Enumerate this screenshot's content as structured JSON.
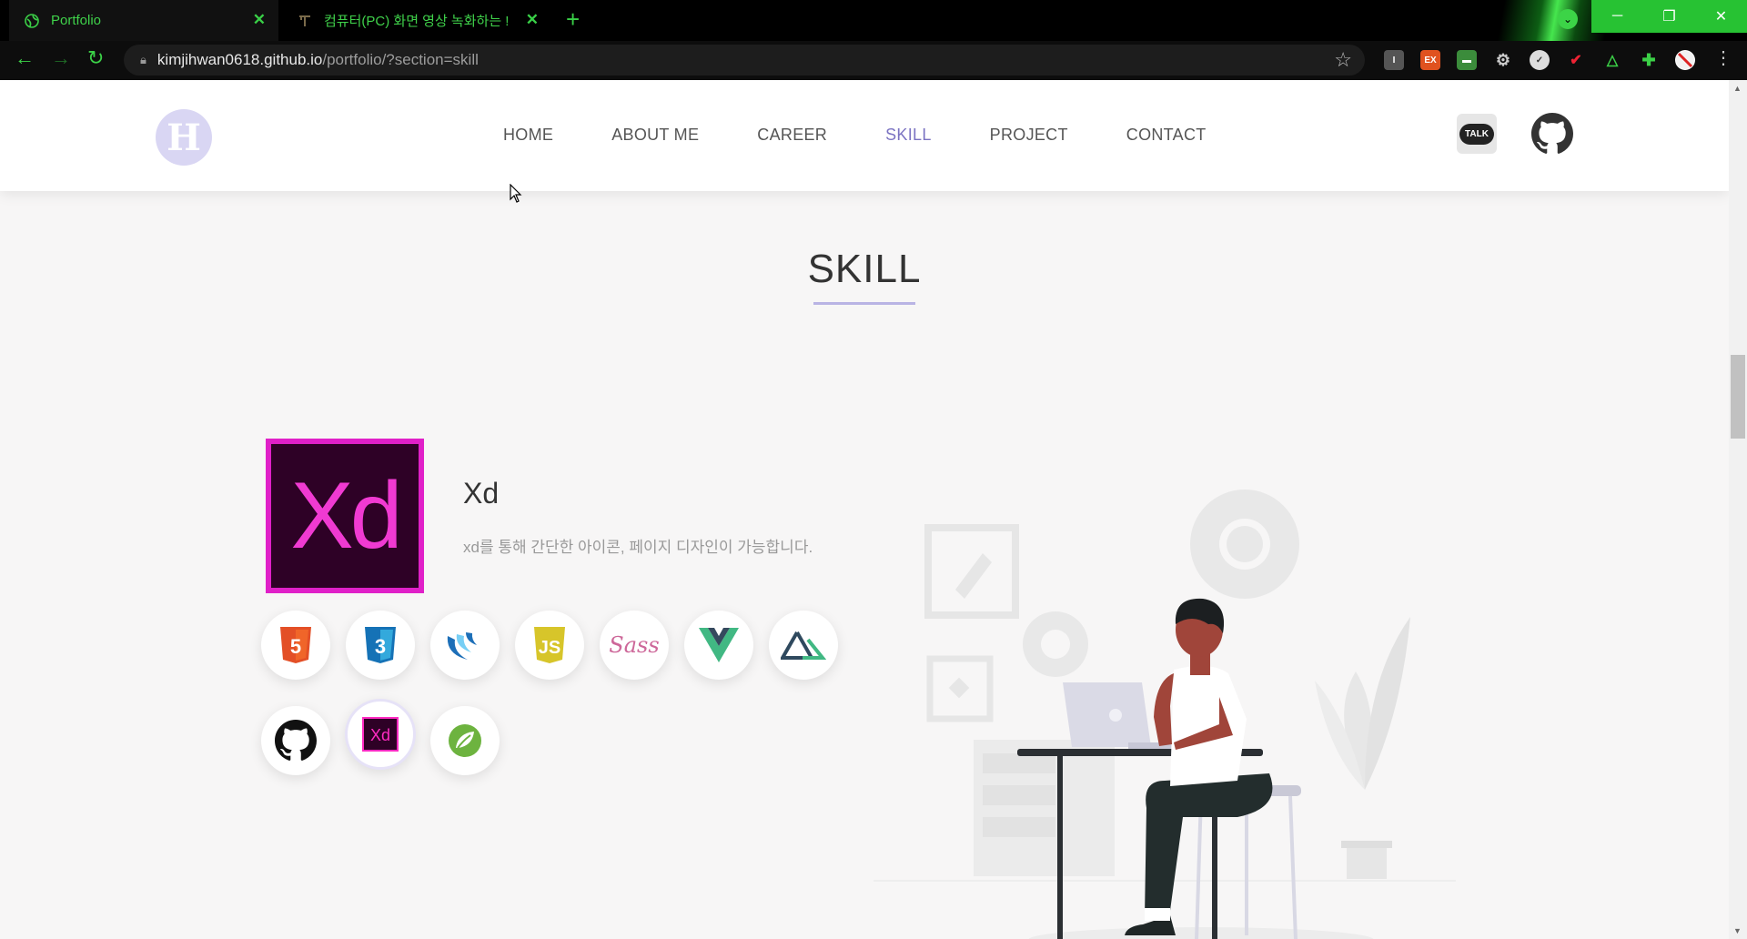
{
  "browser": {
    "tabs": [
      {
        "title": "Portfolio",
        "active": true
      },
      {
        "title": "컴퓨터(PC) 화면 영상 녹화하는 !",
        "active": false
      }
    ],
    "url_host": "kimjihwan0618.github.io",
    "url_path": "/portfolio/?section=skill",
    "accent_color": "#3bd047"
  },
  "header": {
    "logo_letter": "H",
    "menu": [
      {
        "label": "HOME",
        "active": false
      },
      {
        "label": "ABOUT ME",
        "active": false
      },
      {
        "label": "CAREER",
        "active": false
      },
      {
        "label": "SKILL",
        "active": true
      },
      {
        "label": "PROJECT",
        "active": false
      },
      {
        "label": "CONTACT",
        "active": false
      }
    ],
    "talk_label": "TALK"
  },
  "section": {
    "title": "SKILL"
  },
  "selected_skill": {
    "logo_text": "Xd",
    "name": "Xd",
    "description": "xd를 통해 간단한 아이콘, 페이지 디자인이 가능합니다."
  },
  "skill_icons": {
    "row1": [
      {
        "name": "html5-icon",
        "text": "5",
        "color": "#e34f26"
      },
      {
        "name": "css3-icon",
        "text": "3",
        "color": "#1572b6"
      },
      {
        "name": "jquery-icon",
        "text": "",
        "color": "#1d6fb8"
      },
      {
        "name": "javascript-icon",
        "text": "JS",
        "color": "#d7c52a"
      },
      {
        "name": "sass-icon",
        "text": "Sass",
        "color": "#cd6799"
      },
      {
        "name": "vue-icon",
        "text": "",
        "color": "#41b883"
      },
      {
        "name": "nuxt-icon",
        "text": "",
        "color": "#2f495e"
      }
    ],
    "row2": [
      {
        "name": "github-icon",
        "text": "",
        "color": "#111111"
      },
      {
        "name": "xd-icon",
        "text": "Xd",
        "color": "#ff2bc2",
        "selected": true
      },
      {
        "name": "spring-icon",
        "text": "",
        "color": "#6db33f"
      }
    ]
  }
}
